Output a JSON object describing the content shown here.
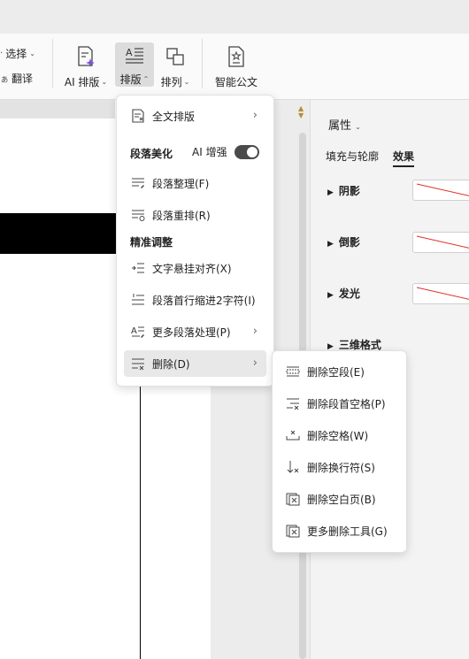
{
  "ribbon": {
    "select_label": "选择",
    "translate_label": "翻译",
    "ai_layout_label": "AI 排版",
    "layout_label": "排版",
    "arrange_label": "排列",
    "smart_doc_label": "智能公文"
  },
  "panel": {
    "properties_label": "属性",
    "tabs": [
      "填充与轮廓",
      "效果"
    ],
    "sections": [
      "阴影",
      "倒影",
      "发光",
      "三维格式"
    ]
  },
  "menu": {
    "full_layout": "全文排版",
    "section_beautify": "段落美化",
    "ai_enhance": "AI 增强",
    "ai_enhance_on": true,
    "para_organize": "段落整理(F)",
    "para_rearrange": "段落重排(R)",
    "section_fine_tune": "精准调整",
    "text_hanging": "文字悬挂对齐(X)",
    "first_indent": "段落首行缩进2字符(I)",
    "more_para": "更多段落处理(P)",
    "delete": "删除(D)"
  },
  "submenu": {
    "items": [
      "删除空段(E)",
      "删除段首空格(P)",
      "删除空格(W)",
      "删除换行符(S)",
      "删除空白页(B)",
      "更多删除工具(G)"
    ]
  },
  "colors": {
    "accent_purple": "#7b4fd6",
    "toggle_dark": "#4a4a4a",
    "tab_underline": "#222222",
    "preview_line": "#e0302a"
  }
}
